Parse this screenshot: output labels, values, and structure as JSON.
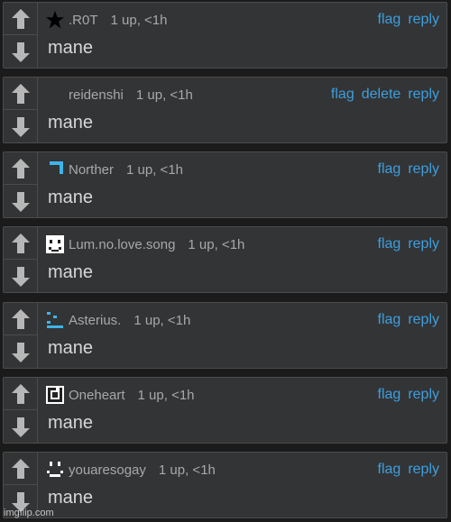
{
  "comments": [
    {
      "user": ".R0T",
      "meta": "1 up, <1h",
      "text": "mane",
      "avatar": "black-star-icon",
      "actions": [
        "flag",
        "reply"
      ]
    },
    {
      "user": "reidenshi",
      "meta": "1 up, <1h",
      "text": "mane",
      "avatar": "none",
      "actions": [
        "flag",
        "delete",
        "reply"
      ]
    },
    {
      "user": "Norther",
      "meta": "1 up, <1h",
      "text": "mane",
      "avatar": "blue-corner-icon",
      "actions": [
        "flag",
        "reply"
      ]
    },
    {
      "user": "Lum.no.love.song",
      "meta": "1 up, <1h",
      "text": "mane",
      "avatar": "pixel-face-icon",
      "actions": [
        "flag",
        "reply"
      ]
    },
    {
      "user": "Asterius.",
      "meta": "1 up, <1h",
      "text": "mane",
      "avatar": "blue-pixel-icon",
      "actions": [
        "flag",
        "reply"
      ]
    },
    {
      "user": "Oneheart",
      "meta": "1 up, <1h",
      "text": "mane",
      "avatar": "square-spiral-icon",
      "actions": [
        "flag",
        "reply"
      ]
    },
    {
      "user": "youaresogay",
      "meta": "1 up, <1h",
      "text": "mane",
      "avatar": "pixel-ghost-icon",
      "actions": [
        "flag",
        "reply"
      ]
    }
  ],
  "watermark": "imgflip.com",
  "colors": {
    "link": "#3d9fde",
    "card": "#333436",
    "text": "#d7d7d7",
    "meta": "#a7a8aa"
  }
}
